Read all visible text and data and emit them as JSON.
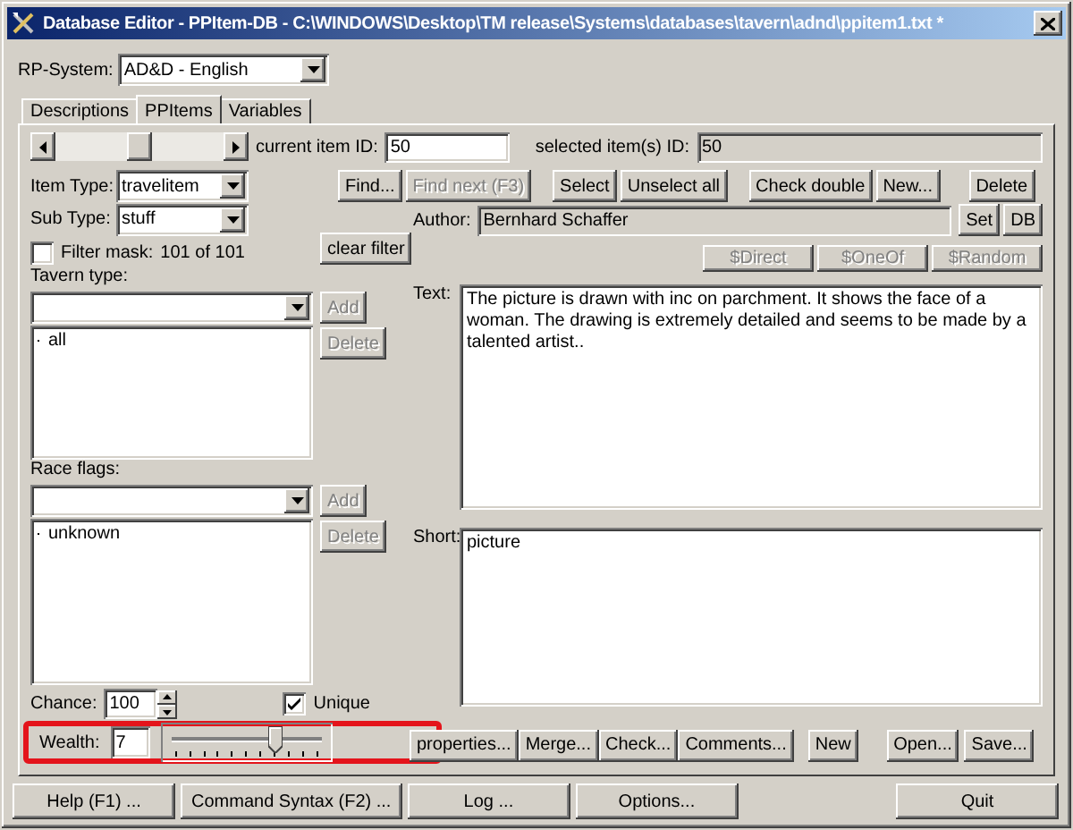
{
  "window": {
    "title": "Database Editor - PPItem-DB - C:\\WINDOWS\\Desktop\\TM release\\Systems\\databases\\tavern\\adnd\\ppitem1.txt *"
  },
  "rp_system": {
    "label": "RP-System:",
    "value": "AD&D - English"
  },
  "tabs": [
    {
      "label": "Descriptions",
      "selected": false
    },
    {
      "label": "PPItems",
      "selected": true
    },
    {
      "label": "Variables",
      "selected": false
    }
  ],
  "navigation": {
    "current_id_label": "current item ID:",
    "current_id": "50",
    "selected_ids_label": "selected item(s) ID:",
    "selected_ids": "50"
  },
  "item_type": {
    "label": "Item Type:",
    "value": "travelitem"
  },
  "sub_type": {
    "label": "Sub Type:",
    "value": "stuff"
  },
  "filter_mask": {
    "label": "Filter mask:",
    "count": "101 of 101",
    "checked": false
  },
  "clear_filter": {
    "label": "clear filter"
  },
  "find_buttons": [
    {
      "label": "Find...",
      "disabled": false
    },
    {
      "label": "Find next (F3)",
      "disabled": true
    }
  ],
  "select_buttons": [
    "Select",
    "Unselect all"
  ],
  "record_buttons": [
    "Check double",
    "New...",
    "Delete"
  ],
  "author": {
    "label": "Author:",
    "value": "Bernhard Schaffer",
    "buttons": [
      "Set",
      "DB"
    ]
  },
  "macro_buttons": [
    {
      "label": "$Direct",
      "disabled": true
    },
    {
      "label": "$OneOf",
      "disabled": true
    },
    {
      "label": "$Random",
      "disabled": true
    }
  ],
  "tavern_type": {
    "label": "Tavern type:",
    "add": {
      "label": "Add",
      "disabled": true
    },
    "delete": {
      "label": "Delete",
      "disabled": true
    },
    "items": [
      "all"
    ]
  },
  "race_flags": {
    "label": "Race flags:",
    "add": {
      "label": "Add",
      "disabled": true
    },
    "delete": {
      "label": "Delete",
      "disabled": true
    },
    "items": [
      "unknown"
    ]
  },
  "text": {
    "label": "Text:",
    "value": "The picture is drawn with inc on parchment. It shows the face of a woman. The drawing is extremely detailed and seems to be made by a talented artist.."
  },
  "short": {
    "label": "Short:",
    "value": "picture"
  },
  "chance": {
    "label": "Chance:",
    "value": "100"
  },
  "unique": {
    "label": "Unique",
    "checked": true
  },
  "wealth": {
    "label": "Wealth:",
    "value": "7",
    "level": 0.7,
    "highlighted": true
  },
  "panel_buttons": [
    "properties...",
    "Merge...",
    "Check...",
    "Comments..."
  ],
  "file_buttons": [
    "New",
    "Open...",
    "Save..."
  ],
  "footer_buttons": [
    "Help (F1) ...",
    "Command Syntax (F2) ...",
    "Log ...",
    "Options..."
  ],
  "quit": "Quit"
}
